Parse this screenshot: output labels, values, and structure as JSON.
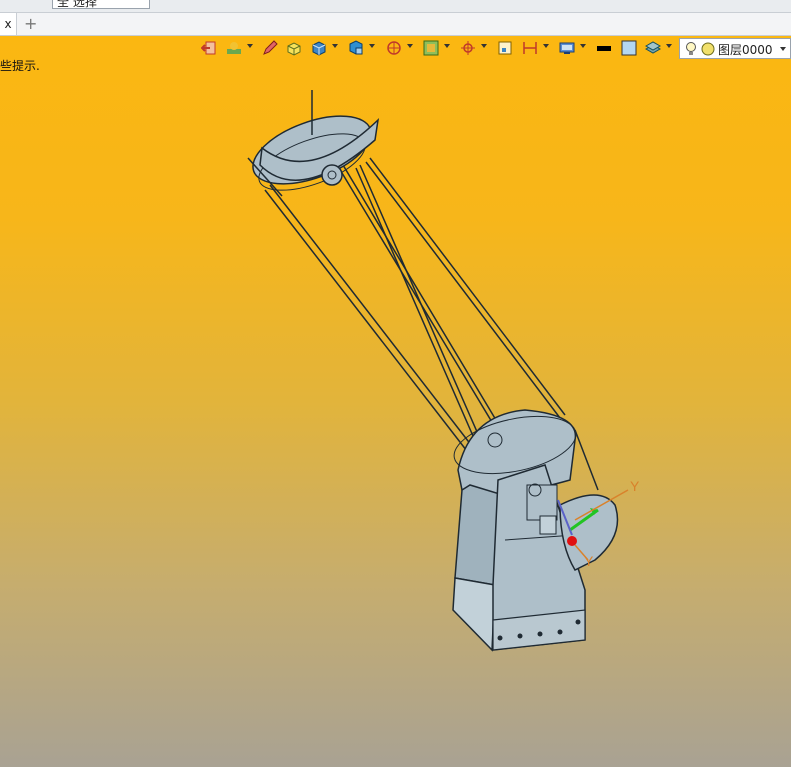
{
  "toolbar": {
    "filter_value": "全 选择"
  },
  "tabs": {
    "active_label": "x",
    "add_label": "+"
  },
  "viewport": {
    "hint_text": "些提示.",
    "layer_selector": {
      "value": "图层0000"
    },
    "axis_labels": {
      "y_top": "Y",
      "y_bottom": "Y"
    }
  },
  "colors": {
    "bg_top": "#fbb711",
    "bg_bottom": "#a9a293",
    "model_fill": "#aebfc9",
    "model_stroke": "#1f2a33",
    "axis_green": "#22c422",
    "axis_red": "#e01010",
    "axis_orange": "#d9822b"
  },
  "icons": [
    "exit-sketch-icon",
    "layer-visibility-icon",
    "pencil-icon",
    "solid-box-icon",
    "blue-cube-icon",
    "view-cube-icon",
    "section-view-icon",
    "render-mode-icon",
    "snap-target-icon",
    "frame-icon",
    "dimension-icon",
    "display-filter-icon",
    "line-color-icon",
    "fill-color-icon",
    "layers-stack-icon",
    "lightbulb-icon",
    "layer-color-icon"
  ]
}
